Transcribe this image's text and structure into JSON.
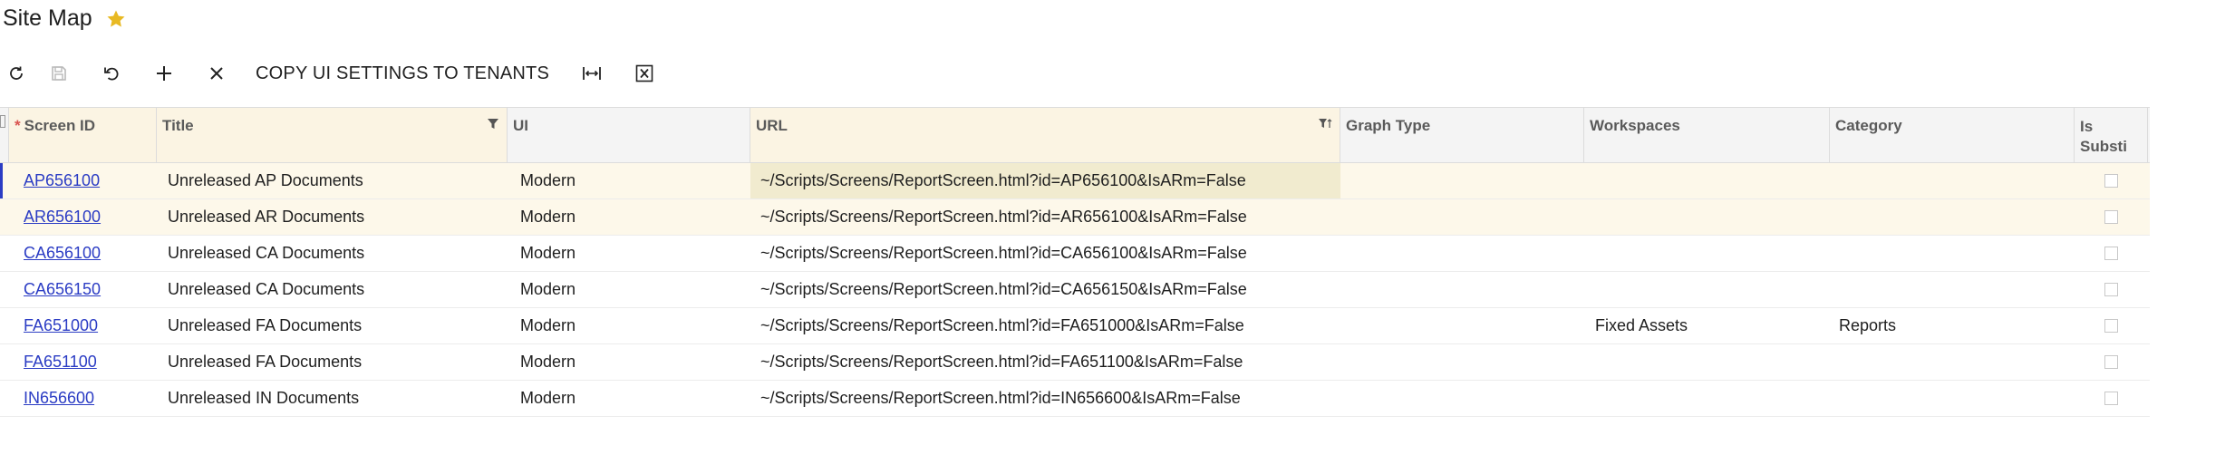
{
  "page": {
    "title": "Site Map"
  },
  "toolbar": {
    "buttons": [
      {
        "name": "refresh-icon"
      },
      {
        "name": "save-icon"
      },
      {
        "name": "undo-icon"
      },
      {
        "name": "add-icon"
      },
      {
        "name": "delete-icon"
      }
    ],
    "copy_label": "COPY UI SETTINGS TO TENANTS",
    "fit_icon": "fit-to-screen-icon",
    "excel_icon": "export-excel-icon"
  },
  "colors": {
    "star": "#e8b923",
    "link": "#2b3cc4",
    "header_bg": "#f4f4f4",
    "highlight_row": "#fdf8ea"
  },
  "grid": {
    "headers": {
      "screen_id": "Screen ID",
      "title": "Title",
      "ui": "UI",
      "url": "URL",
      "graph_type": "Graph Type",
      "workspaces": "Workspaces",
      "category": "Category",
      "is_substitute": "Is Substi"
    },
    "rows": [
      {
        "screen_id": "AP656100",
        "title": "Unreleased AP Documents",
        "ui": "Modern",
        "url": "~/Scripts/Screens/ReportScreen.html?id=AP656100&IsARm=False",
        "graph_type": "",
        "workspaces": "",
        "category": "",
        "is_substitute": false
      },
      {
        "screen_id": "AR656100",
        "title": "Unreleased AR Documents",
        "ui": "Modern",
        "url": "~/Scripts/Screens/ReportScreen.html?id=AR656100&IsARm=False",
        "graph_type": "",
        "workspaces": "",
        "category": "",
        "is_substitute": false
      },
      {
        "screen_id": "CA656100",
        "title": "Unreleased CA Documents",
        "ui": "Modern",
        "url": "~/Scripts/Screens/ReportScreen.html?id=CA656100&IsARm=False",
        "graph_type": "",
        "workspaces": "",
        "category": "",
        "is_substitute": false
      },
      {
        "screen_id": "CA656150",
        "title": "Unreleased CA Documents",
        "ui": "Modern",
        "url": "~/Scripts/Screens/ReportScreen.html?id=CA656150&IsARm=False",
        "graph_type": "",
        "workspaces": "",
        "category": "",
        "is_substitute": false
      },
      {
        "screen_id": "FA651000",
        "title": "Unreleased FA Documents",
        "ui": "Modern",
        "url": "~/Scripts/Screens/ReportScreen.html?id=FA651000&IsARm=False",
        "graph_type": "",
        "workspaces": "Fixed Assets",
        "category": "Reports",
        "is_substitute": false
      },
      {
        "screen_id": "FA651100",
        "title": "Unreleased FA Documents",
        "ui": "Modern",
        "url": "~/Scripts/Screens/ReportScreen.html?id=FA651100&IsARm=False",
        "graph_type": "",
        "workspaces": "",
        "category": "",
        "is_substitute": false
      },
      {
        "screen_id": "IN656600",
        "title": "Unreleased IN Documents",
        "ui": "Modern",
        "url": "~/Scripts/Screens/ReportScreen.html?id=IN656600&IsARm=False",
        "graph_type": "",
        "workspaces": "",
        "category": "",
        "is_substitute": false
      }
    ]
  }
}
